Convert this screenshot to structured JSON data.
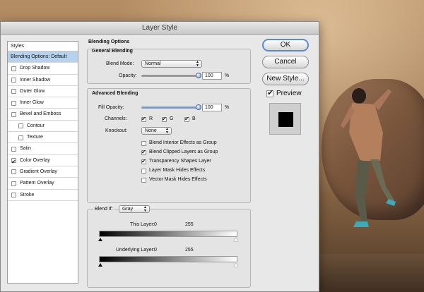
{
  "dialog": {
    "title": "Layer Style"
  },
  "styles_panel": {
    "header": "Styles",
    "items": [
      {
        "label": "Blending Options: Default",
        "selected": true,
        "checkbox": false,
        "checked": false,
        "indent": false
      },
      {
        "label": "Drop Shadow",
        "selected": false,
        "checkbox": true,
        "checked": false,
        "indent": false
      },
      {
        "label": "Inner Shadow",
        "selected": false,
        "checkbox": true,
        "checked": false,
        "indent": false
      },
      {
        "label": "Outer Glow",
        "selected": false,
        "checkbox": true,
        "checked": false,
        "indent": false
      },
      {
        "label": "Inner Glow",
        "selected": false,
        "checkbox": true,
        "checked": false,
        "indent": false
      },
      {
        "label": "Bevel and Emboss",
        "selected": false,
        "checkbox": true,
        "checked": false,
        "indent": false
      },
      {
        "label": "Contour",
        "selected": false,
        "checkbox": true,
        "checked": false,
        "indent": true
      },
      {
        "label": "Texture",
        "selected": false,
        "checkbox": true,
        "checked": false,
        "indent": true
      },
      {
        "label": "Satin",
        "selected": false,
        "checkbox": true,
        "checked": false,
        "indent": false
      },
      {
        "label": "Color Overlay",
        "selected": false,
        "checkbox": true,
        "checked": true,
        "indent": false
      },
      {
        "label": "Gradient Overlay",
        "selected": false,
        "checkbox": true,
        "checked": false,
        "indent": false
      },
      {
        "label": "Pattern Overlay",
        "selected": false,
        "checkbox": true,
        "checked": false,
        "indent": false
      },
      {
        "label": "Stroke",
        "selected": false,
        "checkbox": true,
        "checked": false,
        "indent": false
      }
    ]
  },
  "blending": {
    "title": "Blending Options",
    "general_title": "General Blending",
    "blend_mode_label": "Blend Mode:",
    "blend_mode_value": "Normal",
    "opacity_label": "Opacity:",
    "opacity_value": "100",
    "opacity_level": 1.0,
    "percent": "%",
    "advanced_title": "Advanced Blending",
    "fill_opacity_label": "Fill Opacity:",
    "fill_opacity_value": "100",
    "fill_opacity_level": 1.0,
    "channels_label": "Channels:",
    "channels": [
      {
        "label": "R",
        "checked": true
      },
      {
        "label": "G",
        "checked": true
      },
      {
        "label": "B",
        "checked": true
      }
    ],
    "knockout_label": "Knockout:",
    "knockout_value": "None",
    "options": [
      {
        "label": "Blend Interior Effects as Group",
        "checked": false
      },
      {
        "label": "Blend Clipped Layers as Group",
        "checked": true
      },
      {
        "label": "Transparency Shapes Layer",
        "checked": true
      },
      {
        "label": "Layer Mask Hides Effects",
        "checked": false
      },
      {
        "label": "Vector Mask Hides Effects",
        "checked": false
      }
    ],
    "blend_if_label": "Blend If:",
    "blend_if_value": "Gray",
    "this_layer_label": "This Layer:",
    "this_layer_min": "0",
    "this_layer_max": "255",
    "underlying_label": "Underlying Layer:",
    "underlying_min": "0",
    "underlying_max": "255"
  },
  "buttons": {
    "ok": "OK",
    "cancel": "Cancel",
    "new_style": "New Style...",
    "preview_label": "Preview",
    "preview_checked": true
  }
}
